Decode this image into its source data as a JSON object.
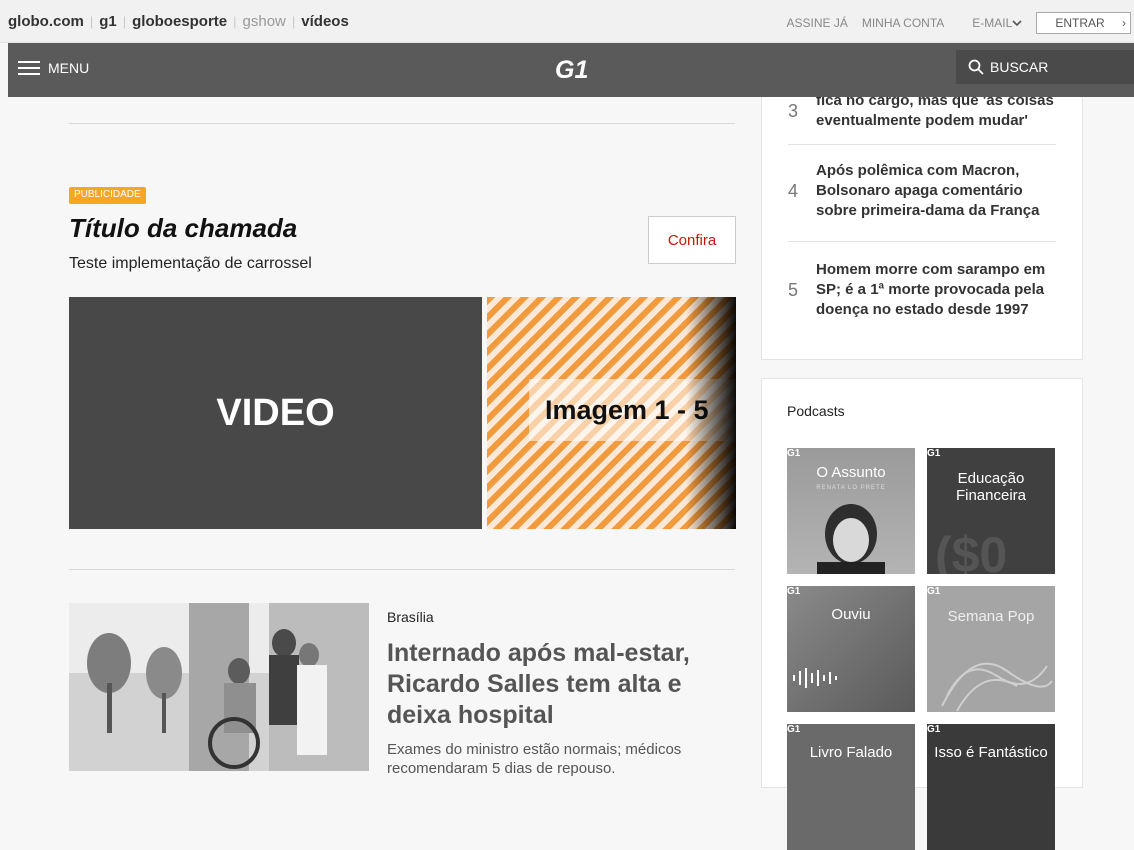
{
  "globo_bar": {
    "links": [
      "globo.com",
      "g1",
      "globoesporte",
      "gshow",
      "vídeos"
    ],
    "assine": "ASSINE JÁ",
    "minha_conta": "MINHA CONTA",
    "email": "E-MAIL",
    "entrar": "ENTRAR"
  },
  "header": {
    "menu_label": "MENU",
    "logo_text": "G1",
    "search_label": "BUSCAR"
  },
  "ad": {
    "badge": "PUBLICIDADE",
    "title": "Título da chamada",
    "subtitle": "Teste implementação de carrossel",
    "cta": "Confira",
    "video_label": "VIDEO",
    "image_label": "Imagem 1 - 5"
  },
  "news": {
    "category": "Brasília",
    "title": "Internado após mal-estar, Ricardo Salles tem alta e deixa hospital",
    "description": "Exames do ministro estão normais; médicos recomendaram 5 dias de repouso."
  },
  "most_read": {
    "items": [
      {
        "num": "3",
        "text": "fica no cargo, mas que 'as coisas eventualmente podem mudar'"
      },
      {
        "num": "4",
        "text": "Após polêmica com Macron, Bolsonaro apaga comentário sobre primeira-dama da França"
      },
      {
        "num": "5",
        "text": "Homem morre com sarampo em SP; é a 1ª morte provocada pela doença no estado desde 1997"
      }
    ]
  },
  "podcasts": {
    "title": "Podcasts",
    "tiles": [
      {
        "name": "O Assunto",
        "sub": "RENATA LO PRETE",
        "g1": "G1"
      },
      {
        "name": "Educação Financeira",
        "g1": "G1"
      },
      {
        "name": "Ouviu",
        "g1": "G1"
      },
      {
        "name": "Semana Pop",
        "g1": "G1"
      },
      {
        "name": "Livro Falado",
        "g1": "G1"
      },
      {
        "name": "Isso é Fantástico",
        "g1": "G1"
      }
    ]
  },
  "colors": {
    "header_bg": "#5a5a5a",
    "badge": "#f5a623",
    "cta_text": "#c4170c"
  }
}
